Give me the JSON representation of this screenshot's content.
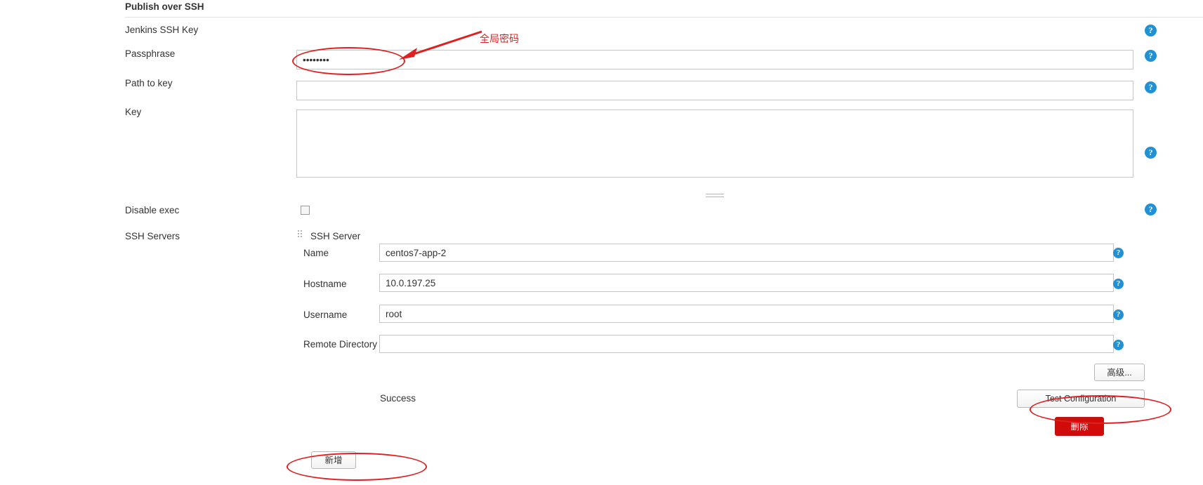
{
  "section": {
    "title": "Publish over SSH"
  },
  "fields": {
    "jenkins_ssh_key_label": "Jenkins SSH Key",
    "passphrase_label": "Passphrase",
    "passphrase_value": "secretpw",
    "path_to_key_label": "Path to key",
    "path_to_key_value": "",
    "key_label": "Key",
    "key_value": "",
    "disable_exec_label": "Disable exec",
    "disable_exec_checked": false,
    "ssh_servers_label": "SSH Servers"
  },
  "ssh_server": {
    "title": "SSH Server",
    "name_label": "Name",
    "name_value": "centos7-app-2",
    "hostname_label": "Hostname",
    "hostname_value": "10.0.197.25",
    "username_label": "Username",
    "username_value": "root",
    "remote_directory_label": "Remote Directory",
    "remote_directory_value": "",
    "advanced_button": "高级...",
    "test_configuration_button": "Test Configuration",
    "test_status": "Success",
    "delete_button": "删除"
  },
  "actions": {
    "add_button": "新增"
  },
  "annotations": {
    "passphrase_note": "全局密码",
    "accent_color": "#e02020"
  },
  "help_icon": {
    "glyph": "?"
  }
}
